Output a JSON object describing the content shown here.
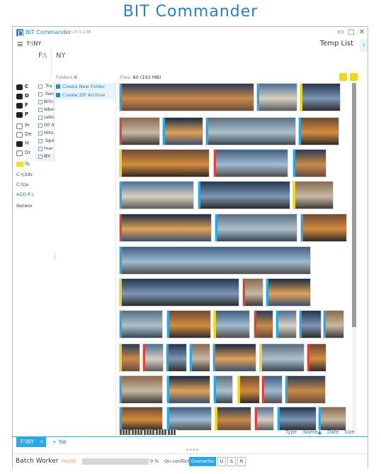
{
  "hero_title": "BIT Commander",
  "window": {
    "app_name": "BIT Commander",
    "version": "v0.5.238",
    "path": "F:\\NY",
    "temp_list_label": "Temp List"
  },
  "crumbs": {
    "drive": "F:\\",
    "folder": "NY"
  },
  "left_panel": {
    "drives": [
      {
        "label": "C",
        "icon": "drive-icon"
      },
      {
        "label": "D",
        "icon": "drive-icon"
      },
      {
        "label": "F",
        "icon": "drive-icon"
      },
      {
        "label": "P",
        "icon": "drive-icon"
      },
      {
        "label": "Pr",
        "icon": "folder-icon"
      },
      {
        "label": "De",
        "icon": "desktop-icon"
      },
      {
        "label": "M",
        "icon": "music-icon"
      },
      {
        "label": "Dr",
        "icon": "dropbox-icon"
      }
    ],
    "beta_label": "To",
    "recent": [
      "C:\\\\3ds",
      "C:\\\\\\a"
    ],
    "add_label": "ADD",
    "add_suffix": "F:\\",
    "network_label": "Networ"
  },
  "path_list": [
    ".Tra",
    ".fsev",
    "Brin",
    "lebo",
    "Lebo",
    "00 S",
    "Hito",
    ".Spo",
    "mar",
    "NY"
  ],
  "folders_header": {
    "label": "Folders",
    "count": "0"
  },
  "files_header": {
    "label": "Files:",
    "count": "60",
    "size": "(192 MB)"
  },
  "actions": [
    {
      "label": "Create New Folder"
    },
    {
      "label": "Create ZIP Archive"
    }
  ],
  "tabs": {
    "active": "F:\\NY",
    "add": "+ Tab"
  },
  "sort": [
    "Type",
    "Name▲",
    "Date",
    "Size"
  ],
  "batch": {
    "title": "Batch Worker",
    "pause": "PAUSE",
    "progress_pct": 0,
    "pct_text": "0 %",
    "conflict_label": "On conflict",
    "overwrite": "Overwrite",
    "u": "U",
    "s": "S",
    "r": "R"
  },
  "colors": {
    "accent": "#29a8e8",
    "brand": "#2a7fc2"
  }
}
